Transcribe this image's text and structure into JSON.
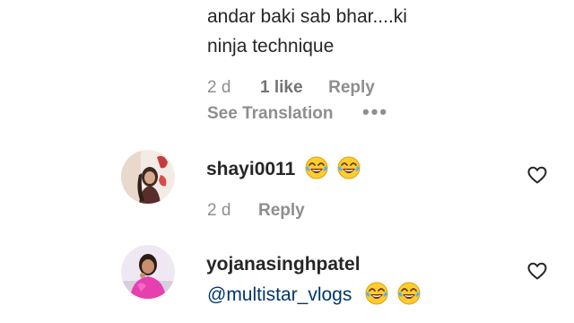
{
  "comments": [
    {
      "text_line1": "andar baki sab bhar....ki",
      "text_line2": "ninja technique",
      "age": "2 d",
      "likes": "1 like",
      "reply_label": "Reply",
      "see_translation": "See Translation",
      "more": "•••"
    },
    {
      "username": "shayi0011",
      "emoji": [
        "face-with-tears-of-joy",
        "face-with-tears-of-joy"
      ],
      "age": "2 d",
      "reply_label": "Reply",
      "like_icon": "heart-outline"
    },
    {
      "username": "yojanasinghpatel",
      "mention": "@multistar_vlogs",
      "emoji": [
        "face-with-tears-of-joy",
        "face-with-tears-of-joy"
      ],
      "like_icon": "heart-outline"
    }
  ],
  "colors": {
    "text": "#262626",
    "muted": "#8e8e8e",
    "mention": "#00376b",
    "background": "#ffffff"
  }
}
